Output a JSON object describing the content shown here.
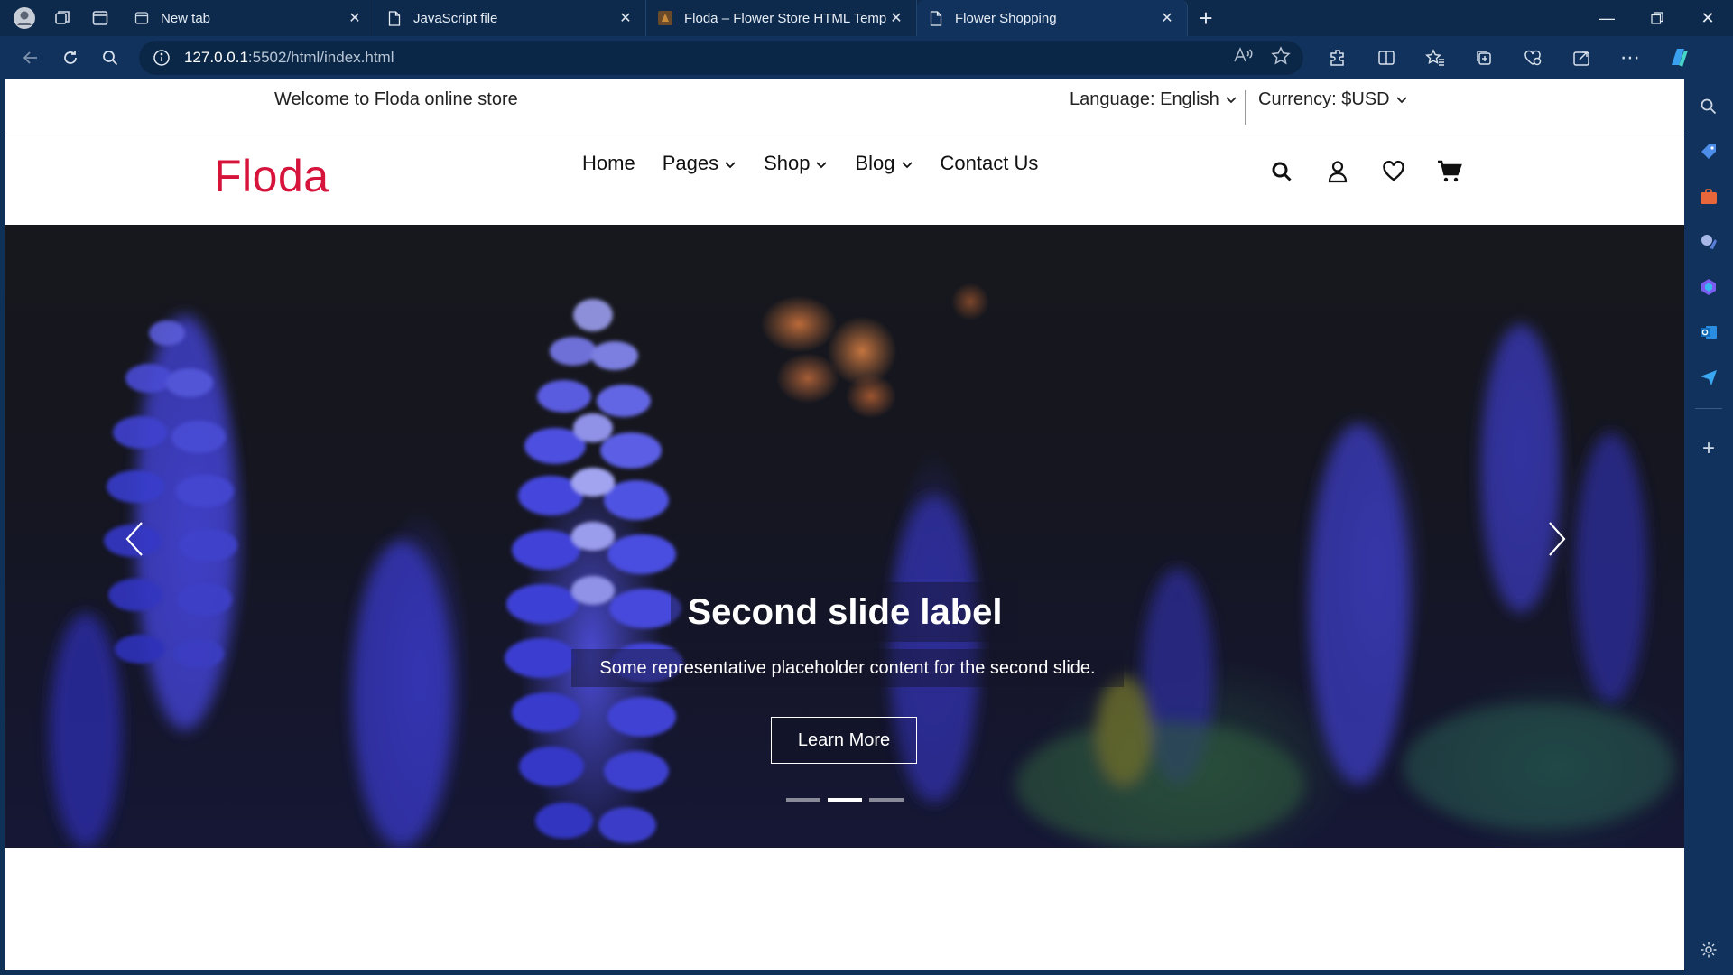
{
  "browser": {
    "tabs": [
      {
        "title": "New tab",
        "active": false
      },
      {
        "title": "JavaScript file",
        "active": false
      },
      {
        "title": "Floda – Flower Store HTML Temp",
        "active": false
      },
      {
        "title": "Flower Shopping",
        "active": true
      }
    ],
    "url_host": "127.0.0.1",
    "url_path": ":5502/html/index.html"
  },
  "topbar": {
    "welcome": "Welcome to Floda online store",
    "language": "Language: English",
    "currency": "Currency: $USD"
  },
  "header": {
    "logo": "Floda",
    "menu": [
      {
        "label": "Home",
        "dropdown": false
      },
      {
        "label": "Pages",
        "dropdown": true
      },
      {
        "label": "Shop",
        "dropdown": true
      },
      {
        "label": "Blog",
        "dropdown": true
      },
      {
        "label": "Contact Us",
        "dropdown": false
      }
    ],
    "icons": [
      "search-icon",
      "user-icon",
      "heart-icon",
      "cart-icon"
    ]
  },
  "hero": {
    "title": "Second slide label",
    "text": "Some representative placeholder content for the second slide.",
    "button": "Learn More",
    "slides_total": 3,
    "active_slide": 2
  },
  "colors": {
    "brand": "#d5133b",
    "chrome_bg": "#10325c"
  }
}
